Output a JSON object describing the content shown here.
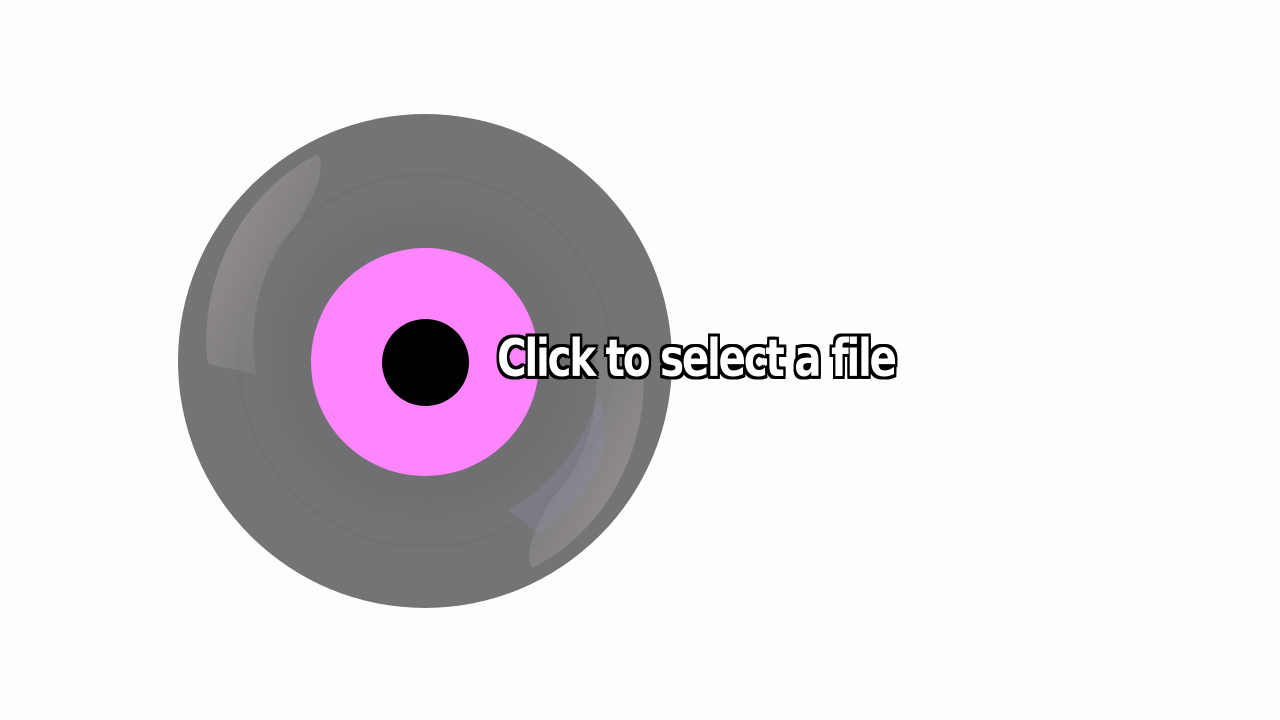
{
  "prompt": {
    "text": "Click to select a file"
  },
  "record": {
    "icon": "vinyl-record-icon",
    "colors": {
      "vinyl": "#757474",
      "label": "#ff85ff",
      "spindle_hole": "#000000",
      "text_fill": "#ffffff",
      "text_outline": "#000000"
    }
  }
}
